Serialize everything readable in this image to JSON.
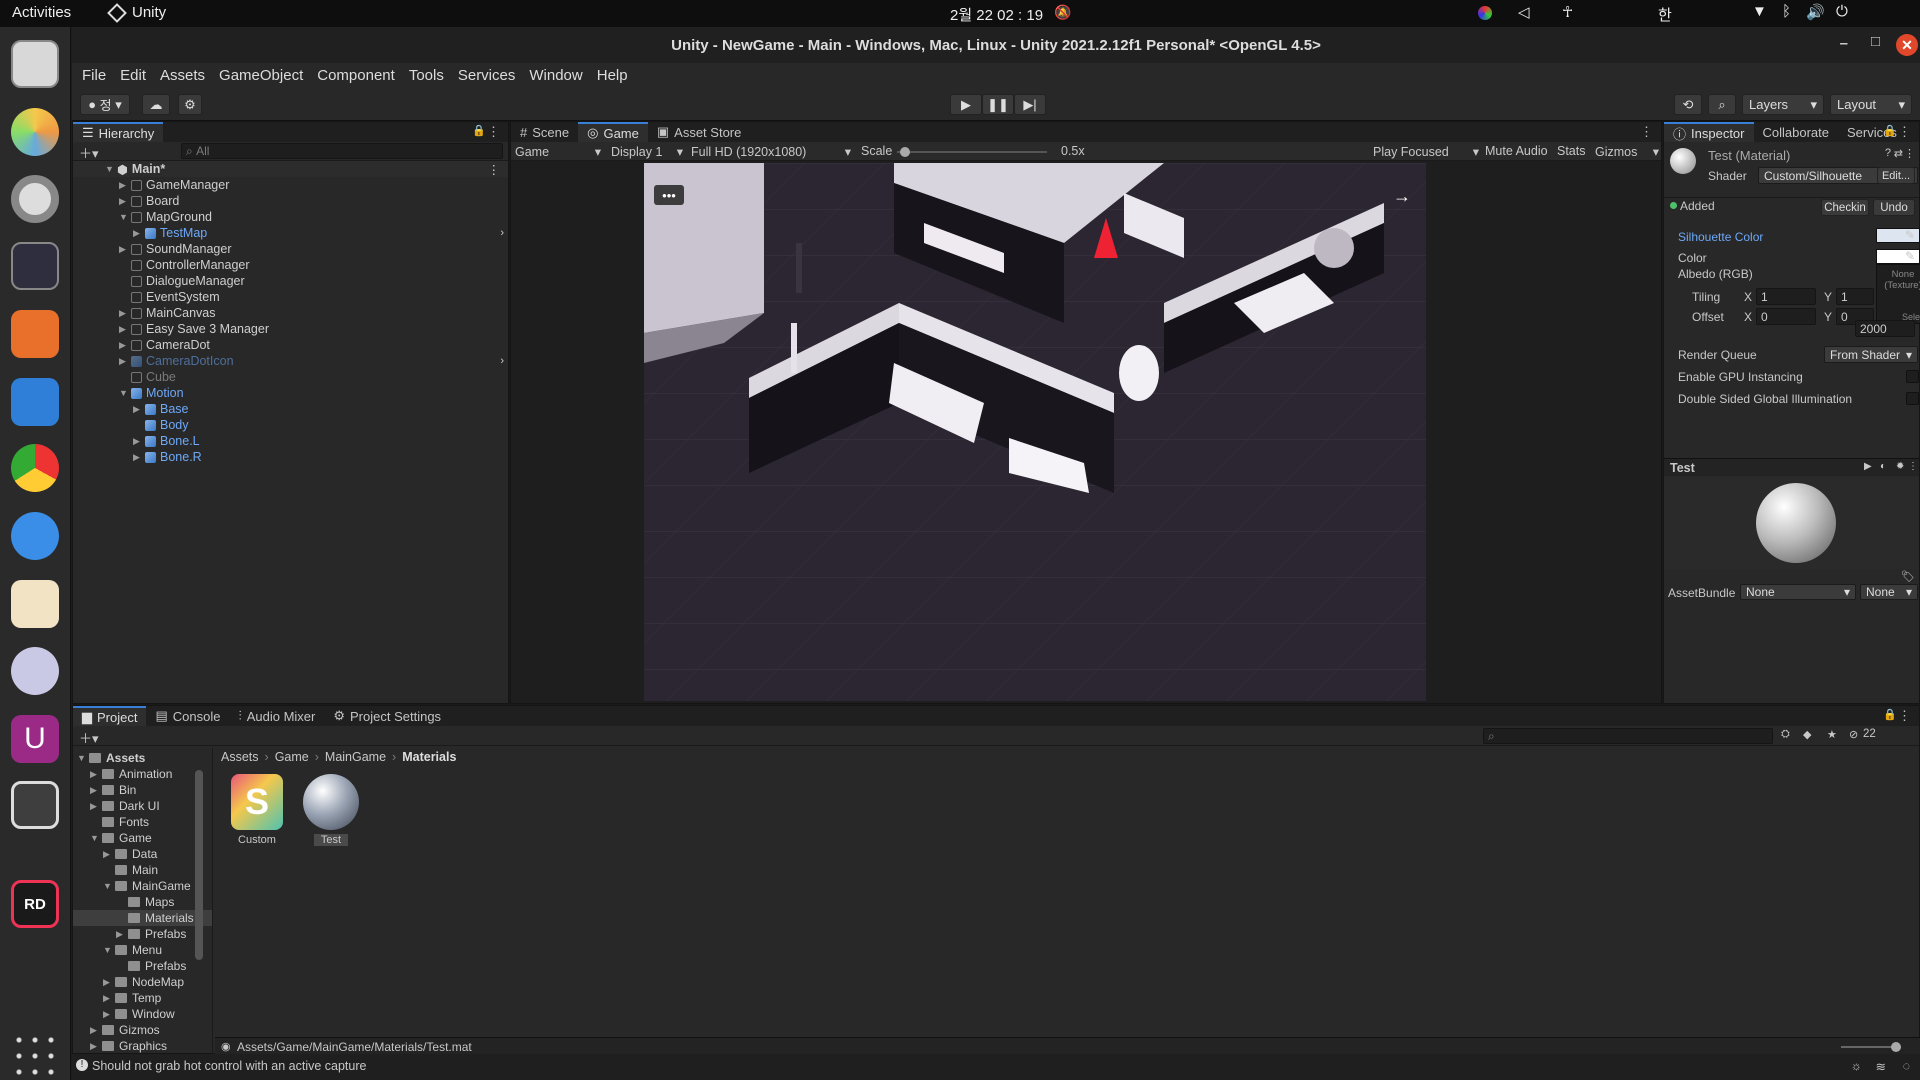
{
  "os": {
    "activities": "Activities",
    "app_name": "Unity",
    "clock": "2월 22  02 : 19",
    "ime": "한"
  },
  "window": {
    "title": "Unity - NewGame - Main - Windows, Mac, Linux - Unity 2021.2.12f1 Personal* <OpenGL 4.5>"
  },
  "menu": [
    "File",
    "Edit",
    "Assets",
    "GameObject",
    "Component",
    "Tools",
    "Services",
    "Window",
    "Help"
  ],
  "toolbar": {
    "account_label": "정",
    "layers_label": "Layers",
    "layout_label": "Layout"
  },
  "hierarchy": {
    "tab_label": "Hierarchy",
    "search_placeholder": "All",
    "scene_name": "Main*",
    "items": [
      {
        "label": "GameManager",
        "depth": 1,
        "expand": true,
        "style": "normal"
      },
      {
        "label": "Board",
        "depth": 1,
        "expand": true,
        "style": "normal"
      },
      {
        "label": "MapGround",
        "depth": 1,
        "expand": "open",
        "style": "normal"
      },
      {
        "label": "TestMap",
        "depth": 2,
        "expand": true,
        "style": "blue",
        "arrow": true
      },
      {
        "label": "SoundManager",
        "depth": 1,
        "expand": true,
        "style": "normal"
      },
      {
        "label": "ControllerManager",
        "depth": 1,
        "expand": false,
        "style": "normal"
      },
      {
        "label": "DialogueManager",
        "depth": 1,
        "expand": false,
        "style": "normal"
      },
      {
        "label": "EventSystem",
        "depth": 1,
        "expand": false,
        "style": "normal"
      },
      {
        "label": "MainCanvas",
        "depth": 1,
        "expand": true,
        "style": "normal"
      },
      {
        "label": "Easy Save 3 Manager",
        "depth": 1,
        "expand": true,
        "style": "normal"
      },
      {
        "label": "CameraDot",
        "depth": 1,
        "expand": true,
        "style": "normal"
      },
      {
        "label": "CameraDotIcon",
        "depth": 1,
        "expand": true,
        "style": "dimblue",
        "arrow": true
      },
      {
        "label": "Cube",
        "depth": 1,
        "expand": false,
        "style": "dim"
      },
      {
        "label": "Motion",
        "depth": 1,
        "expand": "open",
        "style": "blue"
      },
      {
        "label": "Base",
        "depth": 2,
        "expand": true,
        "style": "blue"
      },
      {
        "label": "Body",
        "depth": 2,
        "expand": false,
        "style": "blue"
      },
      {
        "label": "Bone.L",
        "depth": 2,
        "expand": true,
        "style": "blue"
      },
      {
        "label": "Bone.R",
        "depth": 2,
        "expand": true,
        "style": "blue"
      }
    ]
  },
  "game": {
    "tabs": [
      "Scene",
      "Game",
      "Asset Store"
    ],
    "active_tab": "Game",
    "display_mode": "Game",
    "display": "Display 1",
    "resolution": "Full HD (1920x1080)",
    "scale_label": "Scale",
    "scale_value": "0.5x",
    "scale_fraction": 0.05,
    "play_mode": "Play Focused",
    "mute": "Mute Audio",
    "stats": "Stats",
    "gizmos": "Gizmos"
  },
  "inspector": {
    "tabs": [
      "Inspector",
      "Collaborate",
      "Services"
    ],
    "material_name": "Test (Material)",
    "shader_label": "Shader",
    "shader_value": "Custom/Silhouette",
    "edit_button": "Edit...",
    "added_label": "Added",
    "checkin": "Checkin",
    "undo": "Undo",
    "silhouette_color": "Silhouette Color",
    "color_label": "Color",
    "albedo_label": "Albedo (RGB)",
    "texture_none": "None",
    "texture_type": "(Texture)",
    "select": "Select",
    "tiling_label": "Tiling",
    "offset_label": "Offset",
    "x": "X",
    "y": "Y",
    "tiling_x": "1",
    "tiling_y": "1",
    "offset_x": "0",
    "offset_y": "0",
    "render_queue_label": "Render Queue",
    "render_queue_mode": "From Shader",
    "render_queue_value": "2000",
    "gpu_instancing": "Enable GPU Instancing",
    "double_sided": "Double Sided Global Illumination",
    "preview_name": "Test",
    "assetbundle_label": "AssetBundle",
    "assetbundle_value": "None",
    "assetbundle_variant": "None"
  },
  "project": {
    "tabs": [
      "Project",
      "Console",
      "Audio Mixer",
      "Project Settings"
    ],
    "hidden_count": "22",
    "tree": [
      {
        "label": "Assets",
        "depth": 0,
        "expand": "open",
        "bold": true
      },
      {
        "label": "Animation",
        "depth": 1,
        "expand": true
      },
      {
        "label": "Bin",
        "depth": 1,
        "expand": true
      },
      {
        "label": "Dark UI",
        "depth": 1,
        "expand": true
      },
      {
        "label": "Fonts",
        "depth": 1,
        "expand": false
      },
      {
        "label": "Game",
        "depth": 1,
        "expand": "open"
      },
      {
        "label": "Data",
        "depth": 2,
        "expand": true
      },
      {
        "label": "Main",
        "depth": 2,
        "expand": false
      },
      {
        "label": "MainGame",
        "depth": 2,
        "expand": "open"
      },
      {
        "label": "Maps",
        "depth": 3,
        "expand": false
      },
      {
        "label": "Materials",
        "depth": 3,
        "expand": false,
        "selected": true
      },
      {
        "label": "Prefabs",
        "depth": 3,
        "expand": true
      },
      {
        "label": "Menu",
        "depth": 2,
        "expand": "open"
      },
      {
        "label": "Prefabs",
        "depth": 3,
        "expand": false
      },
      {
        "label": "NodeMap",
        "depth": 2,
        "expand": true
      },
      {
        "label": "Temp",
        "depth": 2,
        "expand": true
      },
      {
        "label": "Window",
        "depth": 2,
        "expand": true
      },
      {
        "label": "Gizmos",
        "depth": 1,
        "expand": true
      },
      {
        "label": "Graphics",
        "depth": 1,
        "expand": true
      }
    ],
    "breadcrumb": [
      "Assets",
      "Game",
      "MainGame",
      "Materials"
    ],
    "assets": [
      {
        "label": "Custom",
        "type": "shader",
        "glyph": "S"
      },
      {
        "label": "Test",
        "type": "material"
      }
    ],
    "selected_path": "Assets/Game/MainGame/Materials/Test.mat"
  },
  "status": {
    "message": "Should not grab hot control with an active capture"
  },
  "colors": {
    "accent": "#3a7fd6",
    "link_blue": "#6ea8f7",
    "close_button": "#e0472b",
    "added_dot": "#4ec26b"
  }
}
